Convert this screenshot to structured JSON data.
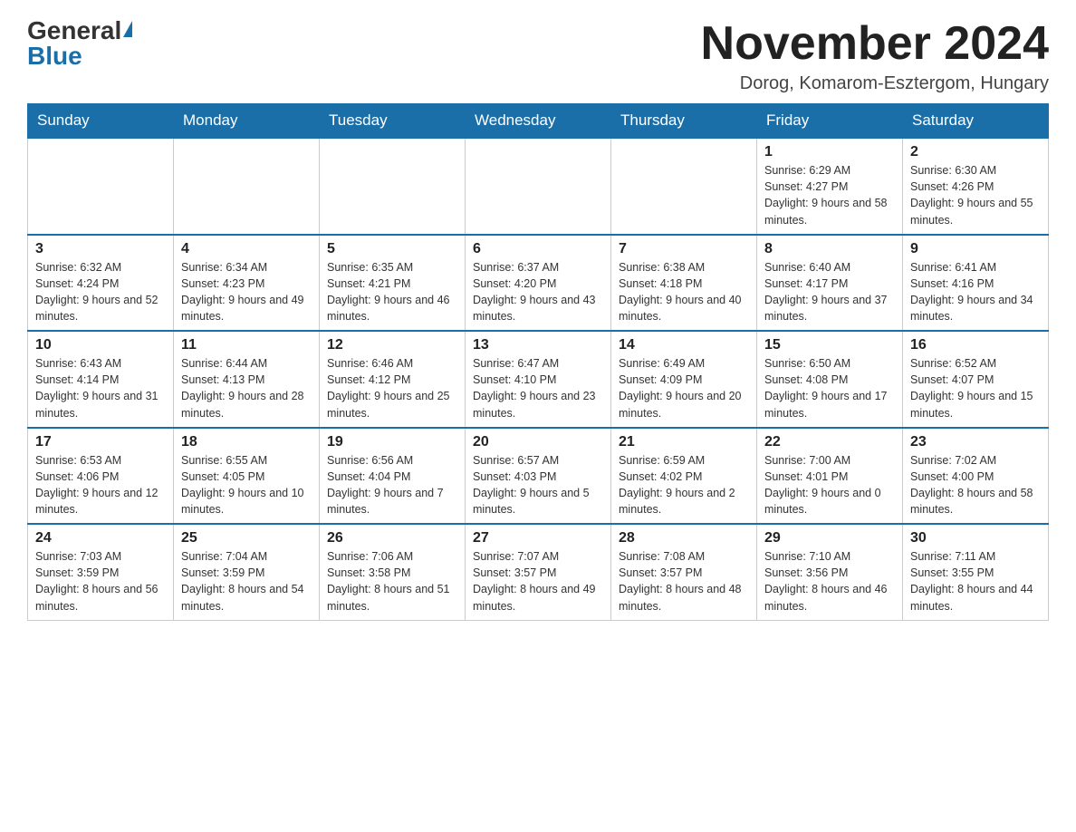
{
  "header": {
    "logo_general": "General",
    "logo_blue": "Blue",
    "month_title": "November 2024",
    "location": "Dorog, Komarom-Esztergom, Hungary"
  },
  "weekdays": [
    "Sunday",
    "Monday",
    "Tuesday",
    "Wednesday",
    "Thursday",
    "Friday",
    "Saturday"
  ],
  "weeks": [
    [
      {
        "day": "",
        "info": ""
      },
      {
        "day": "",
        "info": ""
      },
      {
        "day": "",
        "info": ""
      },
      {
        "day": "",
        "info": ""
      },
      {
        "day": "",
        "info": ""
      },
      {
        "day": "1",
        "info": "Sunrise: 6:29 AM\nSunset: 4:27 PM\nDaylight: 9 hours and 58 minutes."
      },
      {
        "day": "2",
        "info": "Sunrise: 6:30 AM\nSunset: 4:26 PM\nDaylight: 9 hours and 55 minutes."
      }
    ],
    [
      {
        "day": "3",
        "info": "Sunrise: 6:32 AM\nSunset: 4:24 PM\nDaylight: 9 hours and 52 minutes."
      },
      {
        "day": "4",
        "info": "Sunrise: 6:34 AM\nSunset: 4:23 PM\nDaylight: 9 hours and 49 minutes."
      },
      {
        "day": "5",
        "info": "Sunrise: 6:35 AM\nSunset: 4:21 PM\nDaylight: 9 hours and 46 minutes."
      },
      {
        "day": "6",
        "info": "Sunrise: 6:37 AM\nSunset: 4:20 PM\nDaylight: 9 hours and 43 minutes."
      },
      {
        "day": "7",
        "info": "Sunrise: 6:38 AM\nSunset: 4:18 PM\nDaylight: 9 hours and 40 minutes."
      },
      {
        "day": "8",
        "info": "Sunrise: 6:40 AM\nSunset: 4:17 PM\nDaylight: 9 hours and 37 minutes."
      },
      {
        "day": "9",
        "info": "Sunrise: 6:41 AM\nSunset: 4:16 PM\nDaylight: 9 hours and 34 minutes."
      }
    ],
    [
      {
        "day": "10",
        "info": "Sunrise: 6:43 AM\nSunset: 4:14 PM\nDaylight: 9 hours and 31 minutes."
      },
      {
        "day": "11",
        "info": "Sunrise: 6:44 AM\nSunset: 4:13 PM\nDaylight: 9 hours and 28 minutes."
      },
      {
        "day": "12",
        "info": "Sunrise: 6:46 AM\nSunset: 4:12 PM\nDaylight: 9 hours and 25 minutes."
      },
      {
        "day": "13",
        "info": "Sunrise: 6:47 AM\nSunset: 4:10 PM\nDaylight: 9 hours and 23 minutes."
      },
      {
        "day": "14",
        "info": "Sunrise: 6:49 AM\nSunset: 4:09 PM\nDaylight: 9 hours and 20 minutes."
      },
      {
        "day": "15",
        "info": "Sunrise: 6:50 AM\nSunset: 4:08 PM\nDaylight: 9 hours and 17 minutes."
      },
      {
        "day": "16",
        "info": "Sunrise: 6:52 AM\nSunset: 4:07 PM\nDaylight: 9 hours and 15 minutes."
      }
    ],
    [
      {
        "day": "17",
        "info": "Sunrise: 6:53 AM\nSunset: 4:06 PM\nDaylight: 9 hours and 12 minutes."
      },
      {
        "day": "18",
        "info": "Sunrise: 6:55 AM\nSunset: 4:05 PM\nDaylight: 9 hours and 10 minutes."
      },
      {
        "day": "19",
        "info": "Sunrise: 6:56 AM\nSunset: 4:04 PM\nDaylight: 9 hours and 7 minutes."
      },
      {
        "day": "20",
        "info": "Sunrise: 6:57 AM\nSunset: 4:03 PM\nDaylight: 9 hours and 5 minutes."
      },
      {
        "day": "21",
        "info": "Sunrise: 6:59 AM\nSunset: 4:02 PM\nDaylight: 9 hours and 2 minutes."
      },
      {
        "day": "22",
        "info": "Sunrise: 7:00 AM\nSunset: 4:01 PM\nDaylight: 9 hours and 0 minutes."
      },
      {
        "day": "23",
        "info": "Sunrise: 7:02 AM\nSunset: 4:00 PM\nDaylight: 8 hours and 58 minutes."
      }
    ],
    [
      {
        "day": "24",
        "info": "Sunrise: 7:03 AM\nSunset: 3:59 PM\nDaylight: 8 hours and 56 minutes."
      },
      {
        "day": "25",
        "info": "Sunrise: 7:04 AM\nSunset: 3:59 PM\nDaylight: 8 hours and 54 minutes."
      },
      {
        "day": "26",
        "info": "Sunrise: 7:06 AM\nSunset: 3:58 PM\nDaylight: 8 hours and 51 minutes."
      },
      {
        "day": "27",
        "info": "Sunrise: 7:07 AM\nSunset: 3:57 PM\nDaylight: 8 hours and 49 minutes."
      },
      {
        "day": "28",
        "info": "Sunrise: 7:08 AM\nSunset: 3:57 PM\nDaylight: 8 hours and 48 minutes."
      },
      {
        "day": "29",
        "info": "Sunrise: 7:10 AM\nSunset: 3:56 PM\nDaylight: 8 hours and 46 minutes."
      },
      {
        "day": "30",
        "info": "Sunrise: 7:11 AM\nSunset: 3:55 PM\nDaylight: 8 hours and 44 minutes."
      }
    ]
  ]
}
